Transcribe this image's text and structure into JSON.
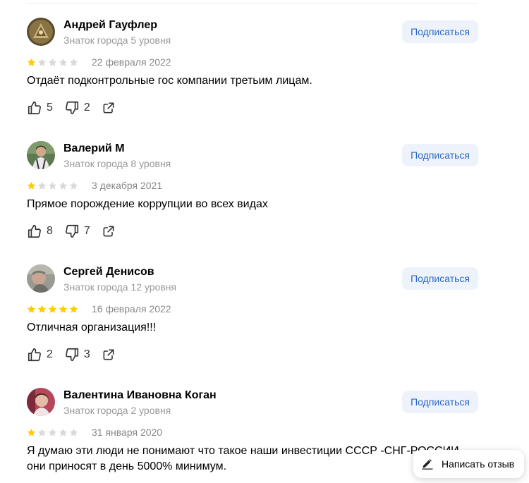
{
  "reviews": [
    {
      "author": "Андрей Гауфлер",
      "level": "Знаток города 5 уровня",
      "subscribe": "Подписаться",
      "rating": 1,
      "date": "22 февраля 2022",
      "text": "Отдаёт подконтрольные гос компании третьим лицам.",
      "likes": "5",
      "dislikes": "2"
    },
    {
      "author": "Валерий М",
      "level": "Знаток города 8 уровня",
      "subscribe": "Подписаться",
      "rating": 1,
      "date": "3 декабря 2021",
      "text": "Прямое порождение коррупции во всех видах",
      "likes": "8",
      "dislikes": "7"
    },
    {
      "author": "Сергей Денисов",
      "level": "Знаток города 12 уровня",
      "subscribe": "Подписаться",
      "rating": 5,
      "date": "16 февраля 2022",
      "text": "Отличная организация!!!",
      "likes": "2",
      "dislikes": "3"
    },
    {
      "author": "Валентина Ивановна Коган",
      "level": "Знаток города 2 уровня",
      "subscribe": "Подписаться",
      "rating": 1,
      "date": "31 января 2020",
      "text": "Я думаю эти люди не понимают что такое наши инвестиции СССР -СНГ-РОССИИ они приносят в день 5000% минимум.",
      "likes": "",
      "dislikes": ""
    }
  ],
  "write_review": {
    "label": "Написать отзыв",
    "icon": "pencil-icon"
  },
  "colors": {
    "star_filled": "#fc0",
    "star_empty": "#d9d9d9",
    "subscribe_bg": "#eef3fb",
    "subscribe_text": "#2c67c4",
    "meta_text": "#999999"
  }
}
